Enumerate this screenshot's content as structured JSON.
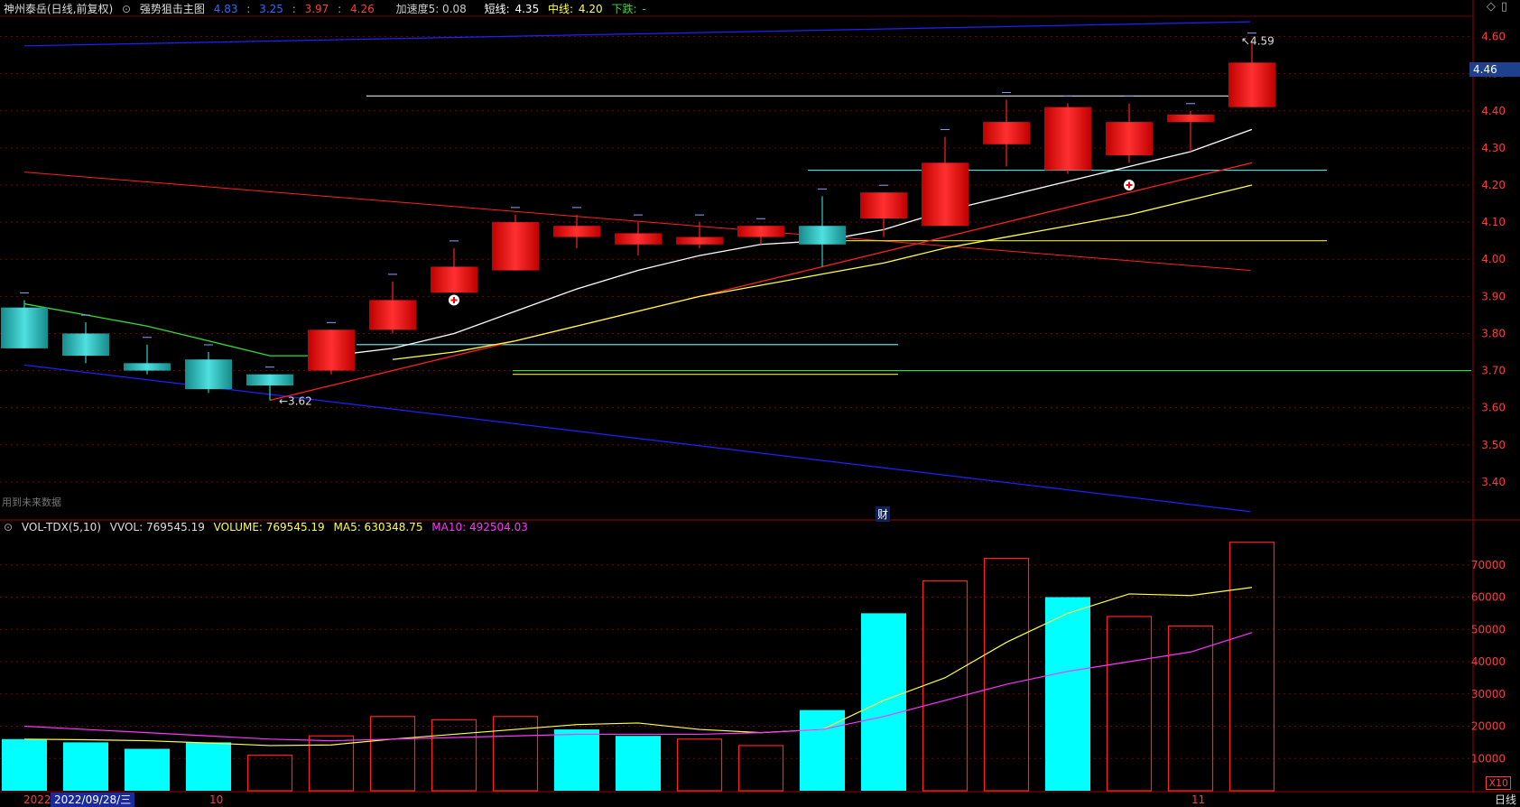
{
  "header": {
    "stock": "神州泰岳(日线,前复权)",
    "indicator": "强势狙击主图",
    "v1": "4.83",
    "v2": "3.25",
    "v3": "3.97",
    "v4": "4.26",
    "accel": "加速度5: 0.08",
    "short_label": "短线:",
    "short_val": "4.35",
    "mid_label": "中线:",
    "mid_val": "4.20",
    "down_label": "下跌:",
    "down_val": "-"
  },
  "volume_header": {
    "name": "VOL-TDX(5,10)",
    "vvol": "VVOL: 769545.19",
    "volume": "VOLUME: 769545.19",
    "ma5": "MA5: 630348.75",
    "ma10": "MA10: 492504.03"
  },
  "price_tag": "4.46",
  "future_note": "用到未来数据",
  "cai_label": "财",
  "x10": "X10",
  "period": "日线",
  "dates": {
    "year": "2022",
    "cursor": "2022/09/28/三",
    "oct": "10",
    "nov": "11"
  },
  "colors": {
    "up": "#ff2020",
    "down": "#35c9c9",
    "grid": "#7a0000",
    "axis": "#ff3b3b",
    "short_line": "#ffffff",
    "mid_line": "#ffff44",
    "red_line": "#ff2020",
    "green_line": "#33dd33",
    "blue_line": "#2020ff"
  },
  "chart_data": [
    {
      "type": "candlestick",
      "title": "强势狙击主图",
      "ylim": [
        3.3,
        4.65
      ],
      "y_ticks": [
        3.4,
        3.5,
        3.6,
        3.7,
        3.8,
        3.9,
        4.0,
        4.1,
        4.2,
        4.3,
        4.4,
        4.5,
        4.6
      ],
      "candles": [
        {
          "open": 3.87,
          "close": 3.76,
          "high": 3.89,
          "low": 3.76
        },
        {
          "open": 3.8,
          "close": 3.74,
          "high": 3.83,
          "low": 3.72
        },
        {
          "open": 3.72,
          "close": 3.7,
          "high": 3.77,
          "low": 3.69
        },
        {
          "open": 3.73,
          "close": 3.65,
          "high": 3.75,
          "low": 3.64
        },
        {
          "open": 3.69,
          "close": 3.66,
          "high": 3.69,
          "low": 3.62
        },
        {
          "open": 3.7,
          "close": 3.81,
          "high": 3.81,
          "low": 3.69
        },
        {
          "open": 3.81,
          "close": 3.89,
          "high": 3.94,
          "low": 3.8
        },
        {
          "open": 3.91,
          "close": 3.98,
          "high": 4.03,
          "low": 3.91
        },
        {
          "open": 3.97,
          "close": 4.1,
          "high": 4.12,
          "low": 3.97
        },
        {
          "open": 4.06,
          "close": 4.09,
          "high": 4.12,
          "low": 4.03
        },
        {
          "open": 4.04,
          "close": 4.07,
          "high": 4.1,
          "low": 4.01
        },
        {
          "open": 4.04,
          "close": 4.06,
          "high": 4.1,
          "low": 4.03
        },
        {
          "open": 4.06,
          "close": 4.09,
          "high": 4.09,
          "low": 4.04
        },
        {
          "open": 4.09,
          "close": 4.04,
          "high": 4.17,
          "low": 3.98
        },
        {
          "open": 4.11,
          "close": 4.18,
          "high": 4.18,
          "low": 4.06
        },
        {
          "open": 4.09,
          "close": 4.26,
          "high": 4.33,
          "low": 4.09
        },
        {
          "open": 4.31,
          "close": 4.37,
          "high": 4.43,
          "low": 4.25
        },
        {
          "open": 4.24,
          "close": 4.41,
          "high": 4.42,
          "low": 4.23
        },
        {
          "open": 4.28,
          "close": 4.37,
          "high": 4.42,
          "low": 4.26
        },
        {
          "open": 4.37,
          "close": 4.39,
          "high": 4.4,
          "low": 4.29
        },
        {
          "open": 4.41,
          "close": 4.53,
          "high": 4.59,
          "low": 4.41
        }
      ],
      "annotations": [
        "3.62",
        "4.59"
      ],
      "short_line": [
        null,
        null,
        null,
        null,
        null,
        3.74,
        3.76,
        3.8,
        3.86,
        3.92,
        3.97,
        4.01,
        4.04,
        4.05,
        4.08,
        4.13,
        4.17,
        4.21,
        4.25,
        4.29,
        4.35
      ],
      "mid_line": [
        null,
        null,
        null,
        null,
        null,
        null,
        3.73,
        3.75,
        3.78,
        3.82,
        3.86,
        3.9,
        3.93,
        3.96,
        3.99,
        4.03,
        4.06,
        4.09,
        4.12,
        4.16,
        4.2
      ],
      "red_line": [
        null,
        null,
        null,
        null,
        3.62,
        3.66,
        3.7,
        3.74,
        3.78,
        3.82,
        3.86,
        3.9,
        3.94,
        3.98,
        4.02,
        4.06,
        4.1,
        4.14,
        4.18,
        4.22,
        4.26
      ],
      "green_line": [
        3.88,
        3.85,
        3.82,
        3.78,
        3.74,
        3.74,
        null,
        null,
        null,
        null,
        null,
        null,
        null,
        null,
        null,
        null,
        null,
        null,
        null,
        null,
        null
      ],
      "horizontal_levels": [
        {
          "value": 4.44,
          "color": "white"
        },
        {
          "value": 4.24,
          "color": "cyan"
        },
        {
          "value": 4.05,
          "color": "yellow"
        },
        {
          "value": 3.77,
          "color": "cyan"
        },
        {
          "value": 3.7,
          "color": "green"
        },
        {
          "value": 3.69,
          "color": "yellow"
        }
      ]
    },
    {
      "type": "bar",
      "title": "VOL-TDX(5,10)",
      "ylim": [
        0,
        80000
      ],
      "y_ticks": [
        10000,
        20000,
        30000,
        40000,
        50000,
        60000,
        70000
      ],
      "values": [
        16000,
        15000,
        13000,
        15000,
        11000,
        17000,
        23000,
        22000,
        23000,
        19000,
        17000,
        16000,
        14000,
        25000,
        55000,
        65000,
        72000,
        60000,
        54000,
        51000,
        77000
      ],
      "up": [
        false,
        false,
        false,
        false,
        true,
        true,
        true,
        true,
        true,
        false,
        false,
        true,
        true,
        false,
        false,
        true,
        true,
        false,
        true,
        true,
        true
      ],
      "ma5": [
        16000,
        15800,
        15500,
        14800,
        14000,
        14200,
        16000,
        17500,
        19000,
        20500,
        21000,
        19000,
        18000,
        19000,
        28000,
        35000,
        46000,
        55000,
        61000,
        60500,
        63000
      ],
      "ma10": [
        20000,
        19000,
        18000,
        17000,
        16000,
        15500,
        16000,
        16500,
        17000,
        17500,
        17500,
        17500,
        18000,
        19000,
        23000,
        28000,
        33000,
        37000,
        40000,
        43000,
        49000
      ]
    }
  ]
}
